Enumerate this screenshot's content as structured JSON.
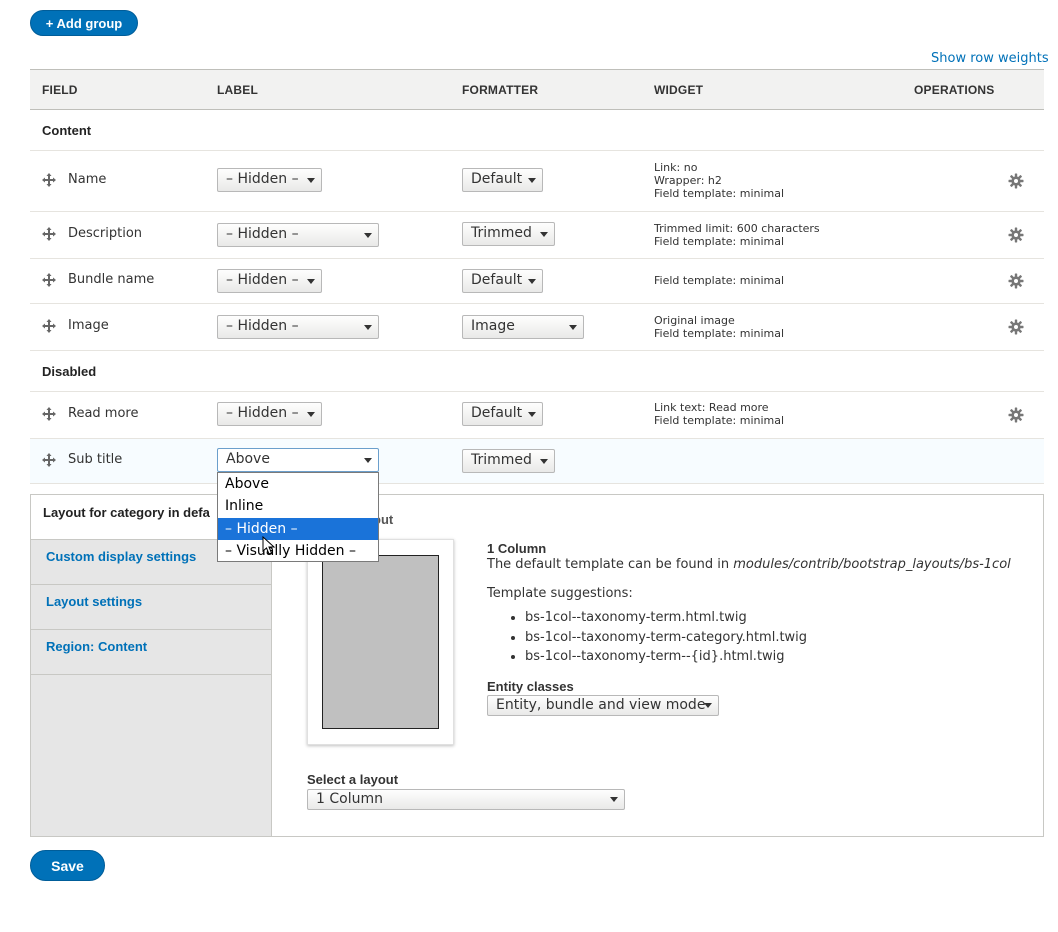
{
  "top": {
    "add_group_label": "+ Add group",
    "show_row_weights": "Show row weights"
  },
  "table": {
    "headers": [
      "Field",
      "Label",
      "Formatter",
      "Widget",
      "Operations"
    ],
    "regions": {
      "content": "Content",
      "disabled": "Disabled"
    },
    "rows": [
      {
        "name": "Name",
        "label": "– Hidden –",
        "formatter": "Default",
        "widget": [
          "Link: no",
          "Wrapper: h2",
          "Field template: minimal"
        ]
      },
      {
        "name": "Description",
        "label": "– Hidden –",
        "formatter": "Trimmed",
        "widget": [
          "Trimmed limit: 600 characters",
          "Field template: minimal"
        ]
      },
      {
        "name": "Bundle name",
        "label": "– Hidden –",
        "formatter": "Default",
        "widget": [
          "Field template: minimal"
        ]
      },
      {
        "name": "Image",
        "label": "– Hidden –",
        "formatter": "Image",
        "widget": [
          "Original image",
          "Field template: minimal"
        ]
      },
      {
        "name": "Read more",
        "label": "– Hidden –",
        "formatter": "Default",
        "widget": [
          "Link text: Read more",
          "Field template: minimal"
        ]
      },
      {
        "name": "Sub title",
        "label": "Above",
        "formatter": "Trimmed",
        "widget": []
      }
    ]
  },
  "dropdown": {
    "options": [
      "Above",
      "Inline",
      "– Hidden –",
      "– Visually Hidden –"
    ],
    "highlighted_index": 2
  },
  "vertical_tabs": {
    "items": [
      "Layout for category in defa",
      "Custom display settings",
      "Layout settings",
      "Region: Content"
    ],
    "pane": {
      "heading_partial": "out",
      "layout_name": "1 Column",
      "template_text": "The default template can be found in",
      "template_path": "modules/contrib/bootstrap_layouts/bs-1col",
      "suggestions_label": "Template suggestions:",
      "suggestions": [
        "bs-1col--taxonomy-term.html.twig",
        "bs-1col--taxonomy-term-category.html.twig",
        "bs-1col--taxonomy-term--{id}.html.twig"
      ],
      "entity_classes_label": "Entity classes",
      "entity_classes_value": "Entity, bundle and view mode",
      "select_layout_label": "Select a layout",
      "select_layout_value": "1 Column"
    }
  },
  "save_label": "Save",
  "colors": {
    "accent": "#0071b8",
    "highlight": "#1a73d9"
  },
  "icons": {
    "drag": "move-cross-icon",
    "settings": "gear-icon",
    "cursor": "mouse-pointer-icon"
  }
}
